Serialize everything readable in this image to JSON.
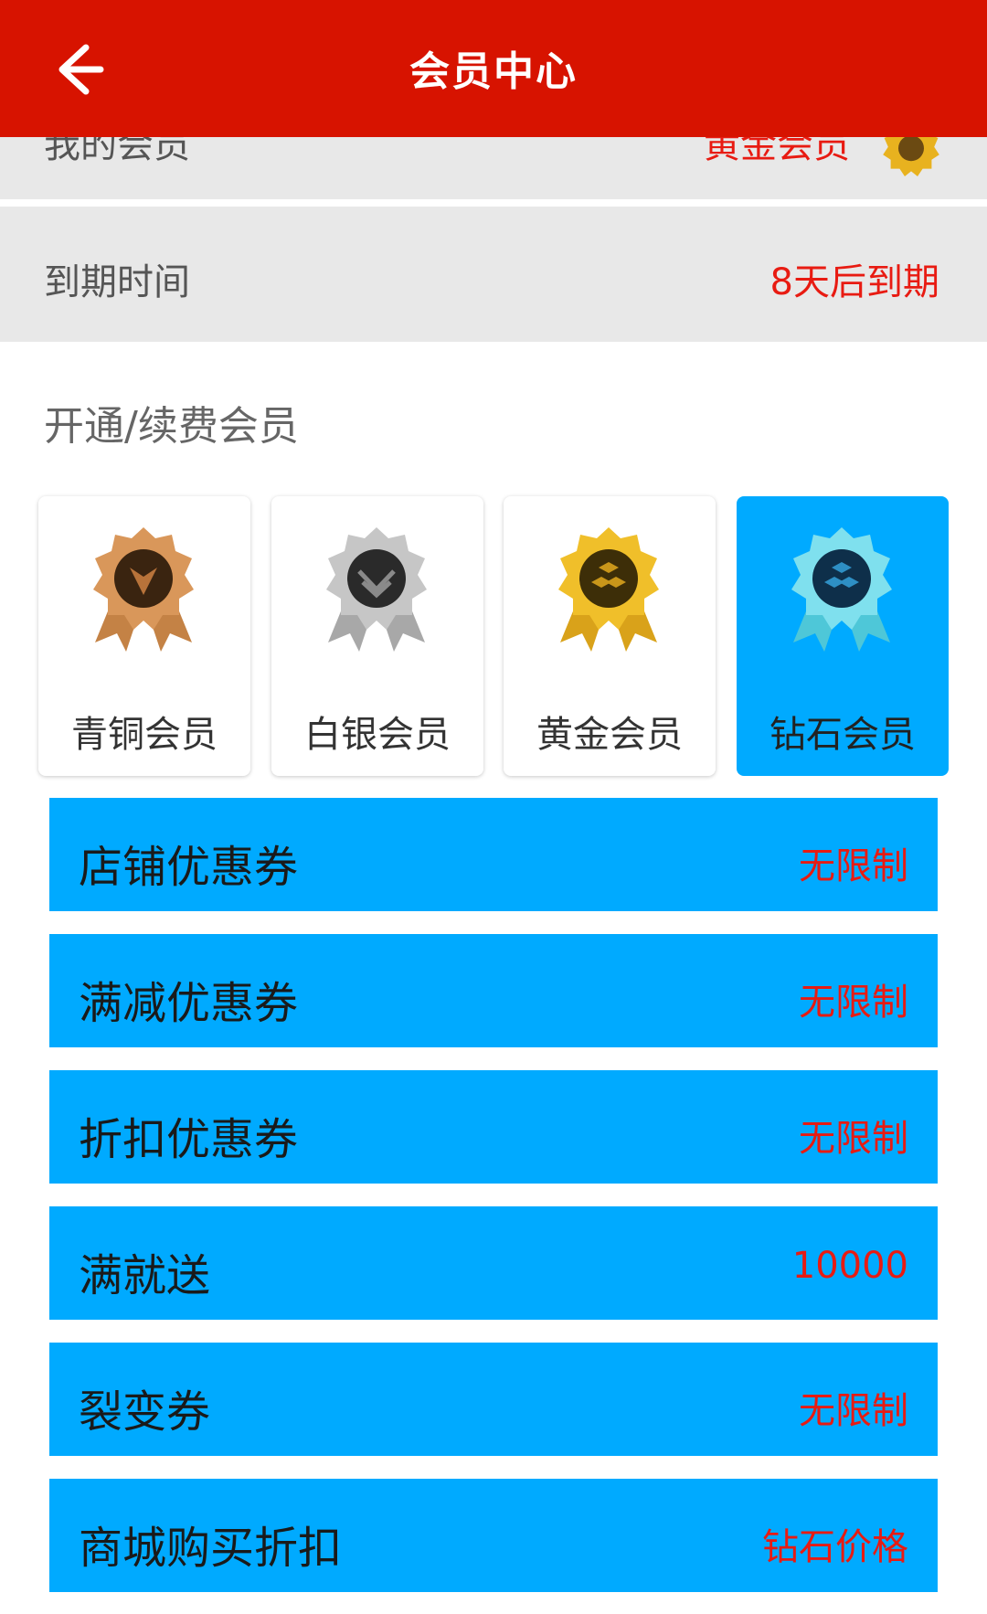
{
  "header": {
    "title": "会员中心",
    "back_icon": "arrow-left-icon"
  },
  "my_member": {
    "label": "我的会员",
    "value": "黄金会员",
    "badge_icon": "gold-medal-icon"
  },
  "expiry": {
    "label": "到期时间",
    "value": "8天后到期"
  },
  "section": {
    "title": "开通/续费会员"
  },
  "tiers": [
    {
      "label": "青铜会员",
      "icon": "bronze-medal-icon",
      "color": "#c98a4b"
    },
    {
      "label": "白银会员",
      "icon": "silver-medal-icon",
      "color": "#b8b8b8"
    },
    {
      "label": "黄金会员",
      "icon": "gold-medal-icon",
      "color": "#e3ad1c"
    },
    {
      "label": "钻石会员",
      "icon": "diamond-medal-icon",
      "color": "#5fd6e8",
      "selected": true
    }
  ],
  "benefits": [
    {
      "name": "店铺优惠券",
      "value": "无限制"
    },
    {
      "name": "满减优惠券",
      "value": "无限制"
    },
    {
      "name": "折扣优惠券",
      "value": "无限制"
    },
    {
      "name": "满就送",
      "value": "10000"
    },
    {
      "name": "裂变券",
      "value": "无限制"
    },
    {
      "name": "商城购买折扣",
      "value": "钻石价格"
    }
  ],
  "colors": {
    "header": "#d71300",
    "accent": "#00aaff",
    "value_red": "#e81b12"
  }
}
